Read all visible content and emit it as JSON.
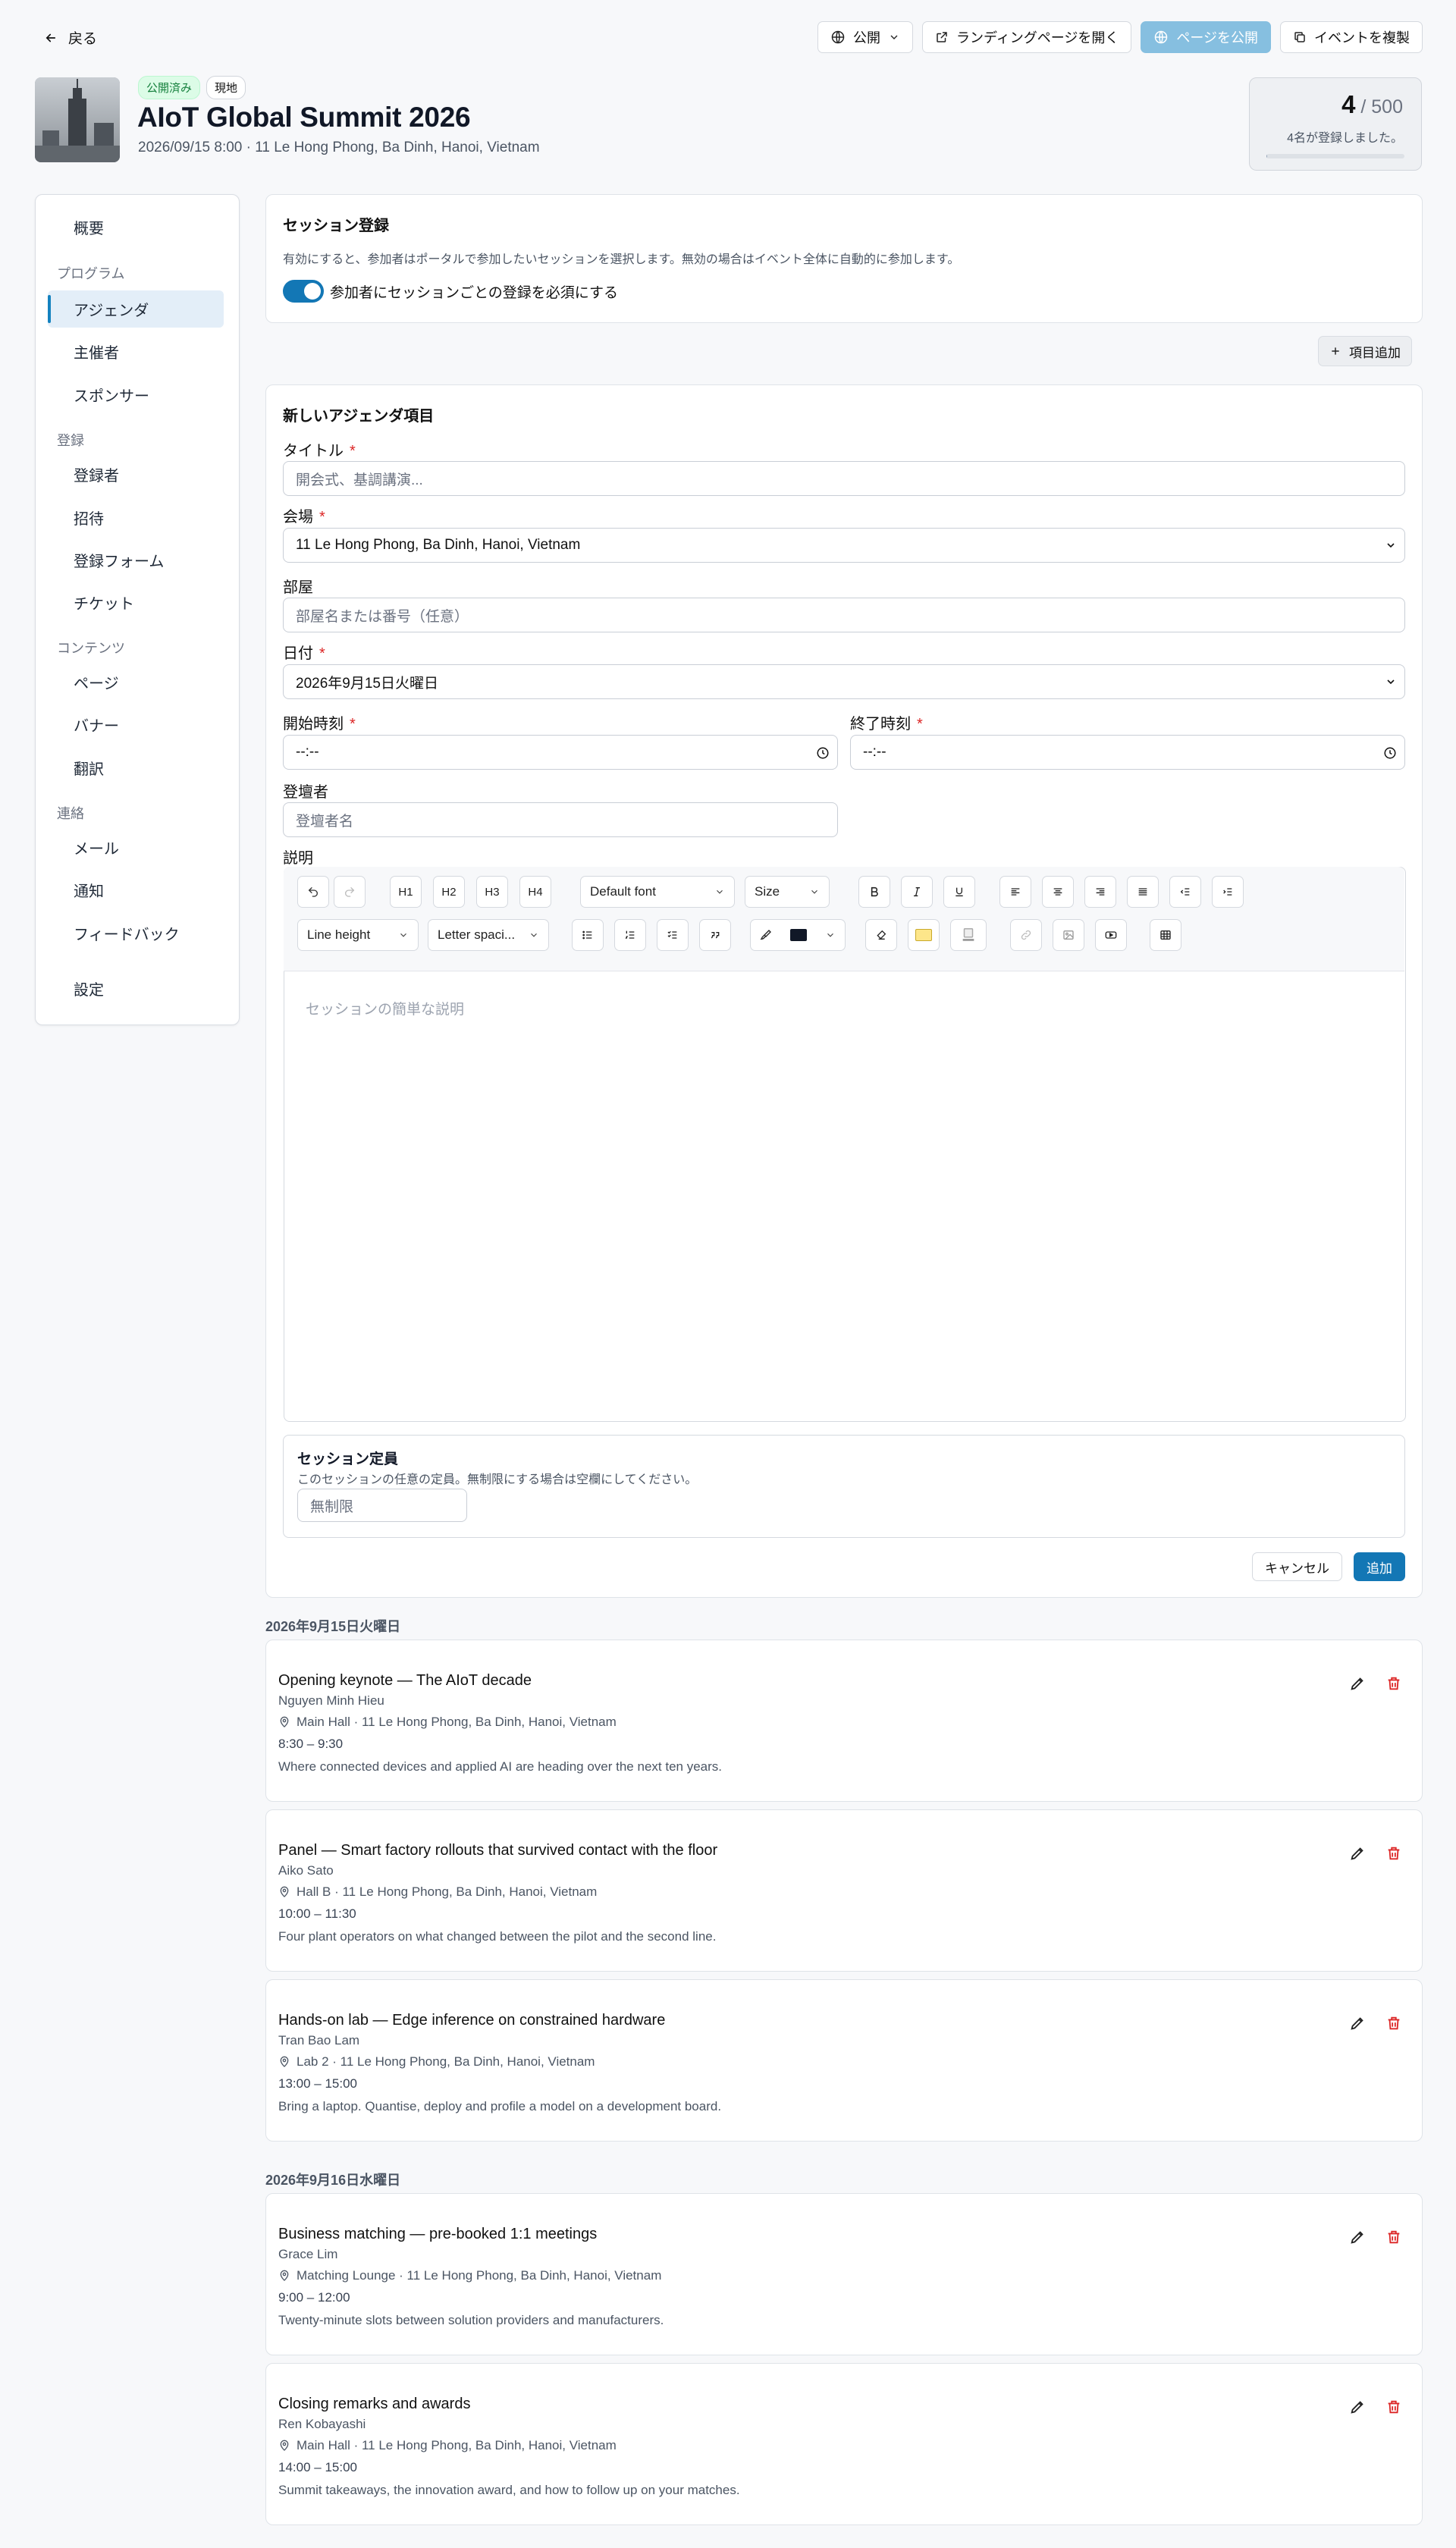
{
  "top": {
    "back_label": "戻る",
    "visibility_label": "公開",
    "open_landing_label": "ランディングページを開く",
    "publish_label": "ページを公開",
    "duplicate_label": "イベントを複製"
  },
  "event": {
    "badge_status": "公開済み",
    "badge_type": "現地",
    "title": "AIoT Global Summit 2026",
    "subtitle": "2026/09/15 8:00 · 11 Le Hong Phong, Ba Dinh, Hanoi, Vietnam",
    "registered": "4",
    "capacity": "/ 500",
    "registered_text": "4名が登録しました。",
    "registered_fraction": 0.008
  },
  "sidebar": {
    "overview": "概要",
    "group_program": "プログラム",
    "agenda": "アジェンダ",
    "organizers": "主催者",
    "sponsors": "スポンサー",
    "group_registration": "登録",
    "registrants": "登録者",
    "invitations": "招待",
    "registration_form": "登録フォーム",
    "tickets": "チケット",
    "group_content": "コンテンツ",
    "pages": "ページ",
    "banners": "バナー",
    "translations": "翻訳",
    "group_contact": "連絡",
    "email": "メール",
    "notifications": "通知",
    "feedback": "フィードバック",
    "settings": "設定"
  },
  "session_reg": {
    "title": "セッション登録",
    "description": "有効にすると、参加者はポータルで参加したいセッションを選択します。無効の場合はイベント全体に自動的に参加します。",
    "toggle_label": "参加者にセッションごとの登録を必須にする"
  },
  "add_item_label": "項目追加",
  "form": {
    "heading": "新しいアジェンダ項目",
    "title_label": "タイトル",
    "title_placeholder": "開会式、基調講演...",
    "venue_label": "会場",
    "venue_value": "11 Le Hong Phong, Ba Dinh, Hanoi, Vietnam",
    "room_label": "部屋",
    "room_placeholder": "部屋名または番号（任意）",
    "date_label": "日付",
    "date_value": "2026年9月15日火曜日",
    "start_label": "開始時刻",
    "start_value": "--:--",
    "end_label": "終了時刻",
    "end_value": "--:--",
    "speaker_label": "登壇者",
    "speaker_placeholder": "登壇者名",
    "desc_label": "説明",
    "desc_placeholder": "セッションの簡単な説明",
    "toolbar": {
      "h1": "H1",
      "h2": "H2",
      "h3": "H3",
      "h4": "H4",
      "font": "Default font",
      "size": "Size",
      "line_height": "Line height",
      "letter_spacing": "Letter spaci...",
      "text_color": "#111827",
      "highlight_color": "#fde68a"
    },
    "capacity_title": "セッション定員",
    "capacity_desc": "このセッションの任意の定員。無制限にする場合は空欄にしてください。",
    "capacity_placeholder": "無制限",
    "cancel_label": "キャンセル",
    "add_label": "追加"
  },
  "agenda": [
    {
      "date": "2026年9月15日火曜日",
      "items": [
        {
          "title": "Opening keynote — The AIoT decade",
          "speaker": "Nguyen Minh Hieu",
          "location": "Main Hall · 11 Le Hong Phong, Ba Dinh, Hanoi, Vietnam",
          "time": "8:30 – 9:30",
          "desc": "Where connected devices and applied AI are heading over the next ten years."
        },
        {
          "title": "Panel — Smart factory rollouts that survived contact with the floor",
          "speaker": "Aiko Sato",
          "location": "Hall B · 11 Le Hong Phong, Ba Dinh, Hanoi, Vietnam",
          "time": "10:00 – 11:30",
          "desc": "Four plant operators on what changed between the pilot and the second line."
        },
        {
          "title": "Hands-on lab — Edge inference on constrained hardware",
          "speaker": "Tran Bao Lam",
          "location": "Lab 2 · 11 Le Hong Phong, Ba Dinh, Hanoi, Vietnam",
          "time": "13:00 – 15:00",
          "desc": "Bring a laptop. Quantise, deploy and profile a model on a development board."
        }
      ]
    },
    {
      "date": "2026年9月16日水曜日",
      "items": [
        {
          "title": "Business matching — pre-booked 1:1 meetings",
          "speaker": "Grace Lim",
          "location": "Matching Lounge · 11 Le Hong Phong, Ba Dinh, Hanoi, Vietnam",
          "time": "9:00 – 12:00",
          "desc": "Twenty-minute slots between solution providers and manufacturers."
        },
        {
          "title": "Closing remarks and awards",
          "speaker": "Ren Kobayashi",
          "location": "Main Hall · 11 Le Hong Phong, Ba Dinh, Hanoi, Vietnam",
          "time": "14:00 – 15:00",
          "desc": "Summit takeaways, the innovation award, and how to follow up on your matches."
        }
      ]
    }
  ]
}
